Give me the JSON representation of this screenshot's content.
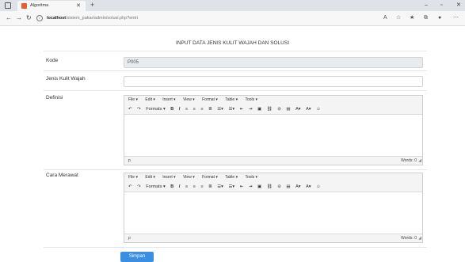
{
  "browser": {
    "tab_title": "Algoritma",
    "url_host": "localhost",
    "url_path": "/sistem_pakar/admin/solusi.php?entri"
  },
  "page": {
    "title": "INPUT DATA JENIS KULIT WAJAH DAN SOLUSI"
  },
  "form": {
    "kode_label": "Kode",
    "kode_value": "P005",
    "jenis_label": "Jenis Kulit Wajah",
    "jenis_value": "",
    "definisi_label": "Definisi",
    "cara_label": "Cara Merawat",
    "submit_label": "Simpan"
  },
  "editor": {
    "menus": [
      "File ▾",
      "Edit ▾",
      "Insert ▾",
      "View ▾",
      "Format ▾",
      "Table ▾",
      "Tools ▾"
    ],
    "formats_label": "Formats ▾",
    "path": "p",
    "words": "Words: 0"
  }
}
